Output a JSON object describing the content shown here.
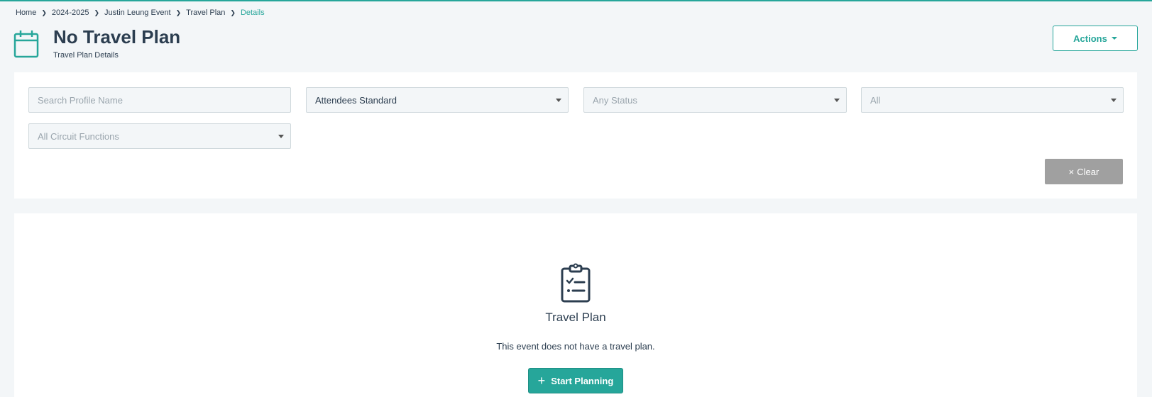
{
  "breadcrumb": {
    "items": [
      "Home",
      "2024-2025",
      "Justin Leung Event",
      "Travel Plan"
    ],
    "active": "Details"
  },
  "header": {
    "icon": "calendar-icon",
    "title": "No Travel Plan",
    "subtitle": "Travel Plan Details",
    "actions_label": "Actions"
  },
  "filters": {
    "search_placeholder": "Search Profile Name",
    "attendee_type": "Attendees Standard",
    "status": "Any Status",
    "scope": "All",
    "circuit_functions": "All Circuit Functions",
    "clear_label": "Clear",
    "clear_icon": "×"
  },
  "empty_state": {
    "icon": "clipboard-checklist-icon",
    "title": "Travel Plan",
    "message": "This event does not have a travel plan.",
    "button_label": "Start Planning",
    "button_icon": "+"
  },
  "colors": {
    "accent": "#26a69a",
    "text": "#2c3e50",
    "background": "#f3f6f8",
    "clear_button": "#a0a0a0"
  }
}
